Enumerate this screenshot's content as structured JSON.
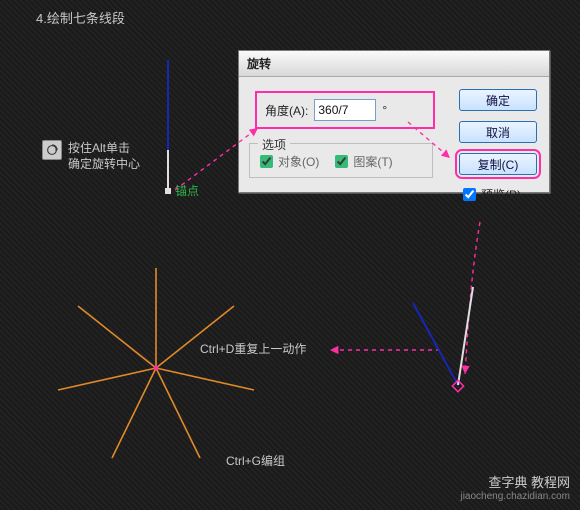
{
  "step_title": "4.绘制七条线段",
  "hint": {
    "line1": "按住Alt单击",
    "line2": "确定旋转中心"
  },
  "anchor_label": "锚点",
  "dialog": {
    "title": "旋转",
    "angle_label": "角度(A):",
    "angle_value": "360/7",
    "angle_unit": "°",
    "options_legend": "选项",
    "chk_object": "对象(O)",
    "chk_pattern": "图案(T)",
    "btn_ok": "确定",
    "btn_cancel": "取消",
    "btn_copy": "复制(C)",
    "chk_preview": "预览(P)"
  },
  "labels": {
    "ctrl_d": "Ctrl+D重复上一动作",
    "ctrl_g": "Ctrl+G编组"
  },
  "watermark": {
    "cn": "查字典 教程网",
    "url": "jiaocheng.chazidian.com"
  }
}
